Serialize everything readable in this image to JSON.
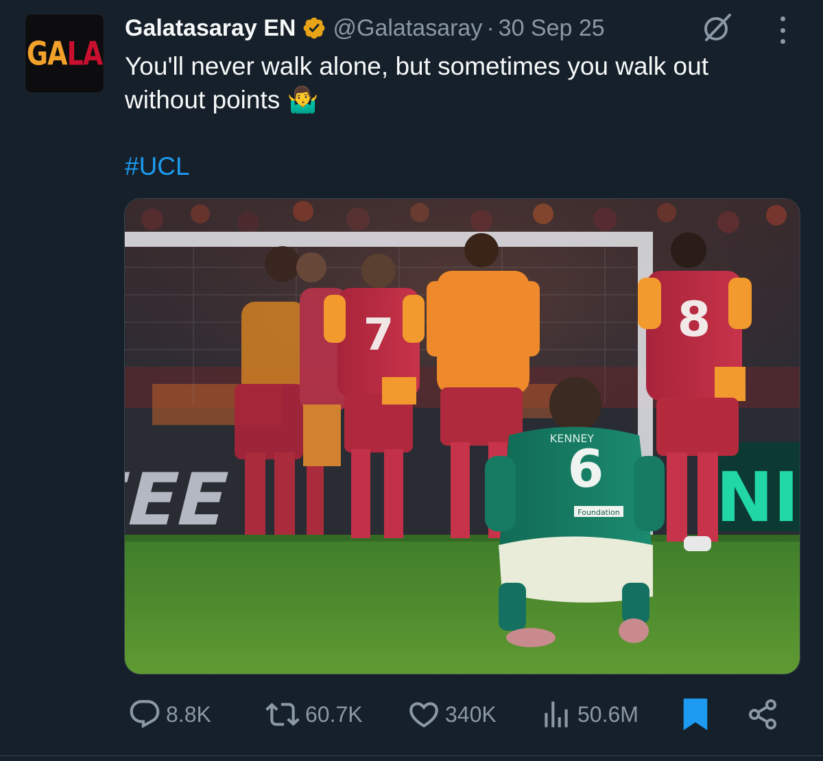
{
  "tweet": {
    "author": {
      "display_name": "Galatasaray EN",
      "handle": "@Galatasaray",
      "verified": true,
      "verified_badge_color": "#e8a317",
      "avatar_logo": {
        "part1": "GA",
        "part2": "LA",
        "color1": "#f2a12a",
        "color2": "#c8102e"
      }
    },
    "separator": "·",
    "date": "30 Sep 25",
    "text_line1": "You'll never walk alone, but sometimes you walk out",
    "text_line2": "without points 🤷‍♂️",
    "hashtag": "#UCL",
    "media": {
      "description_icon": "photo",
      "jersey_numbers": {
        "red_a": "7",
        "red_b": "8",
        "green": "6"
      },
      "jersey_name": "KENNEY",
      "sponsor": "Foundation",
      "ad_board_left": "-FEE",
      "ad_board_right": "NIG"
    },
    "stats": {
      "replies": "8.8K",
      "reposts": "60.7K",
      "likes": "340K",
      "views": "50.6M"
    },
    "icons": {
      "grok": "grok-icon",
      "more": "more-icon",
      "reply": "reply-icon",
      "repost": "repost-icon",
      "like": "like-icon",
      "views": "views-icon",
      "bookmark": "bookmark-icon",
      "share": "share-icon"
    },
    "colors": {
      "background": "#15202b",
      "text": "#f7f9f9",
      "secondary": "#8b98a5",
      "link": "#1d9bf0",
      "bookmark_active": "#1d9bf0"
    }
  }
}
